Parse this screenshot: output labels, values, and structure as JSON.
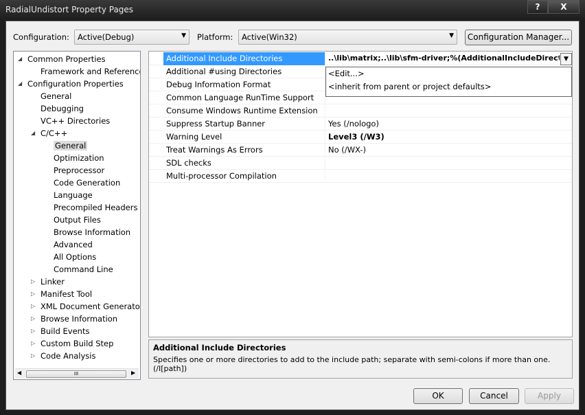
{
  "window": {
    "title": "RadialUndistort Property Pages",
    "help": "?",
    "close": "X"
  },
  "toolbar": {
    "configuration_label": "Configuration:",
    "configuration_value": "Active(Debug)",
    "platform_label": "Platform:",
    "platform_value": "Active(Win32)",
    "config_manager": "Configuration Manager..."
  },
  "tree": [
    {
      "label": "Common Properties",
      "level": 0,
      "toggle": "expanded"
    },
    {
      "label": "Framework and References",
      "level": 1
    },
    {
      "label": "Configuration Properties",
      "level": 0,
      "toggle": "expanded"
    },
    {
      "label": "General",
      "level": 1
    },
    {
      "label": "Debugging",
      "level": 1
    },
    {
      "label": "VC++ Directories",
      "level": 1
    },
    {
      "label": "C/C++",
      "level": 1,
      "toggle": "expanded"
    },
    {
      "label": "General",
      "level": 2,
      "selected": true
    },
    {
      "label": "Optimization",
      "level": 2
    },
    {
      "label": "Preprocessor",
      "level": 2
    },
    {
      "label": "Code Generation",
      "level": 2
    },
    {
      "label": "Language",
      "level": 2
    },
    {
      "label": "Precompiled Headers",
      "level": 2
    },
    {
      "label": "Output Files",
      "level": 2
    },
    {
      "label": "Browse Information",
      "level": 2
    },
    {
      "label": "Advanced",
      "level": 2
    },
    {
      "label": "All Options",
      "level": 2
    },
    {
      "label": "Command Line",
      "level": 2
    },
    {
      "label": "Linker",
      "level": 1,
      "toggle": "collapsed"
    },
    {
      "label": "Manifest Tool",
      "level": 1,
      "toggle": "collapsed"
    },
    {
      "label": "XML Document Generator",
      "level": 1,
      "toggle": "collapsed"
    },
    {
      "label": "Browse Information",
      "level": 1,
      "toggle": "collapsed"
    },
    {
      "label": "Build Events",
      "level": 1,
      "toggle": "collapsed"
    },
    {
      "label": "Custom Build Step",
      "level": 1,
      "toggle": "collapsed"
    },
    {
      "label": "Code Analysis",
      "level": 1,
      "toggle": "collapsed"
    }
  ],
  "tree_scroll_grip": "III",
  "grid": [
    {
      "name": "Additional Include Directories",
      "value": "..\\lib\\matrix;..\\lib\\sfm-driver;%(AdditionalIncludeDirectories)",
      "selected": true
    },
    {
      "name": "Additional #using Directories",
      "value": ""
    },
    {
      "name": "Debug Information Format",
      "value": ""
    },
    {
      "name": "Common Language RunTime Support",
      "value": ""
    },
    {
      "name": "Consume Windows Runtime Extension",
      "value": ""
    },
    {
      "name": "Suppress Startup Banner",
      "value": "Yes (/nologo)"
    },
    {
      "name": "Warning Level",
      "value": "Level3 (/W3)",
      "bold": true
    },
    {
      "name": "Treat Warnings As Errors",
      "value": "No (/WX-)"
    },
    {
      "name": "SDL checks",
      "value": ""
    },
    {
      "name": "Multi-processor Compilation",
      "value": ""
    }
  ],
  "dropdown": {
    "options": [
      "<Edit...>",
      "<inherit from parent or project defaults>"
    ]
  },
  "description": {
    "title": "Additional Include Directories",
    "text": "Specifies one or more directories to add to the include path; separate with semi-colons if more than one.",
    "switch": "(/I[path])"
  },
  "buttons": {
    "ok": "OK",
    "cancel": "Cancel",
    "apply": "Apply"
  }
}
